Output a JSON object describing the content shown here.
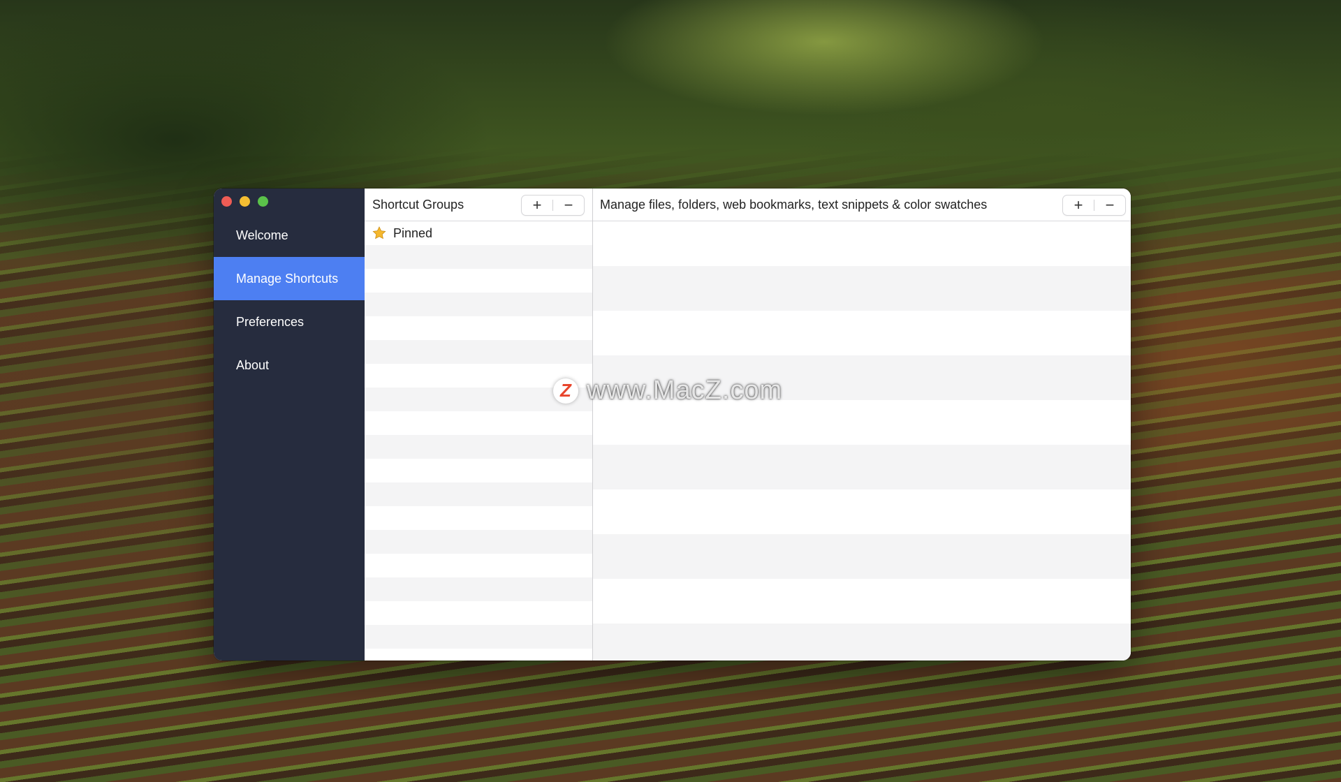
{
  "sidebar": {
    "items": [
      {
        "label": "Welcome",
        "active": false
      },
      {
        "label": "Manage Shortcuts",
        "active": true
      },
      {
        "label": "Preferences",
        "active": false
      },
      {
        "label": "About",
        "active": false
      }
    ]
  },
  "groups_panel": {
    "title": "Shortcut Groups",
    "add_label": "+",
    "remove_label": "−",
    "items": [
      {
        "label": "Pinned",
        "icon": "star-icon"
      }
    ]
  },
  "content_panel": {
    "title": "Manage files, folders, web bookmarks, text snippets & color swatches",
    "add_label": "+",
    "remove_label": "−"
  },
  "watermark": {
    "logo": "Z",
    "text": "www.MacZ.com"
  },
  "colors": {
    "sidebar_bg": "#262c3e",
    "accent": "#4d7ff2",
    "close": "#ee5c55",
    "minimize": "#f5be32",
    "zoom": "#5bc24a",
    "star": "#f5b82e"
  }
}
